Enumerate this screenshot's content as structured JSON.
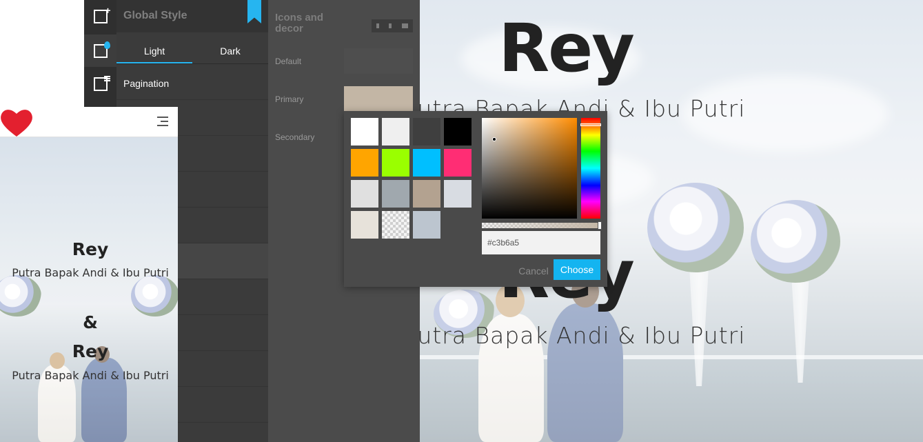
{
  "preview": {
    "name": "Rey",
    "subtitle": "Putra Bapak Andi & Ibu Putri",
    "name_second": "Rey",
    "subtitle_second": "Putra Bapak Andi & Ibu Putri"
  },
  "icon_rail": {
    "items": [
      {
        "icon": "add-section-icon"
      },
      {
        "icon": "global-style-icon"
      },
      {
        "icon": "page-settings-icon"
      }
    ]
  },
  "global_style": {
    "title": "Global Style",
    "tabs": [
      {
        "label": "Light",
        "active": true
      },
      {
        "label": "Dark",
        "active": false
      }
    ],
    "items": [
      {
        "label": "Pagination"
      },
      {
        "label": ""
      },
      {
        "label": "ary"
      },
      {
        "label": "ondary"
      },
      {
        "label": ""
      },
      {
        "label": "ecor"
      },
      {
        "label": ""
      },
      {
        "label": ""
      },
      {
        "label": ""
      },
      {
        "label": ""
      }
    ]
  },
  "decor_panel": {
    "title": "Icons and decor",
    "fields": [
      {
        "label": "Default",
        "color": "#4e4e4e"
      },
      {
        "label": "Primary",
        "color": "#c3b6a5"
      },
      {
        "label": "Secondary",
        "color": "#4b4b4b"
      }
    ]
  },
  "color_picker": {
    "presets": [
      "#ffffff",
      "#efefef",
      "#3f3f3f",
      "#000000",
      "#ffa500",
      "#9aff00",
      "#00bfff",
      "#ff2d74",
      "#e0e0e0",
      "#a0a8ae",
      "#b3a290",
      "#d8dce2",
      "#e7e2da",
      "transparent",
      "#bcc5cf"
    ],
    "hue_color": "#ff8c00",
    "hex_value": "#c3b6a5",
    "cancel_label": "Cancel",
    "choose_label": "Choose"
  },
  "mobile": {
    "logo": "heart-icon",
    "name": "Rey",
    "subtitle": "Putra Bapak Andi & Ibu Putri",
    "ampersand": "&",
    "name_second": "Rey",
    "subtitle_second": "Putra Bapak Andi & Ibu Putri"
  },
  "colors": {
    "accent": "#26b5f0",
    "choose_button": "#14b4f0",
    "heart": "#e3202f"
  }
}
